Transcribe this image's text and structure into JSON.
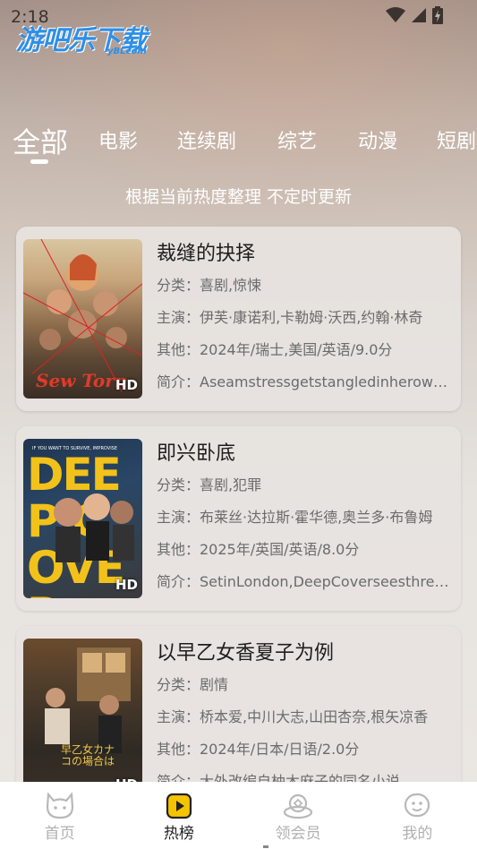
{
  "status_bar": {
    "time": "2:18"
  },
  "watermark": {
    "brand": "游吧乐下载",
    "domain": "yBLcom"
  },
  "tabs": [
    {
      "label": "全部",
      "active": true
    },
    {
      "label": "电影"
    },
    {
      "label": "连续剧"
    },
    {
      "label": "综艺"
    },
    {
      "label": "动漫"
    },
    {
      "label": "短剧"
    }
  ],
  "subtitle": "根据当前热度整理 不定时更新",
  "movies": [
    {
      "title": "裁缝的抉择",
      "genre": "分类：喜剧,惊悚",
      "cast": "主演：伊芙·康诺利,卡勒姆·沃西,约翰·林奇",
      "other": "其他：2024年/瑞士,美国/英语/9.0分",
      "intro": "简介：Aseamstressgetstangledinherownthreads",
      "poster_text": "Sew Torn",
      "badge": "HD"
    },
    {
      "title": "即兴卧底",
      "genre": "分类：喜剧,犯罪",
      "cast": "主演：布莱丝·达拉斯·霍华德,奥兰多·布鲁姆",
      "other": "其他：2025年/英国/英语/8.0分",
      "intro": "简介：SetinLondon,DeepCoverseesthreeimprov",
      "poster_text": "DEEP COVER",
      "poster_tagline": "IF YOU WANT TO SURVIVE, IMPROVISE",
      "badge": "HD"
    },
    {
      "title": "以早乙女香夏子为例",
      "genre": "分类：剧情",
      "cast": "主演：桥本爱,中川大志,山田杏奈,根矢凉香",
      "other": "其他：2024年/日本/日语/2.0分",
      "intro": "简介：大外改编自柚木麻子的同名小说",
      "poster_text": "早乙女カナコの場合は",
      "badge": "HD"
    }
  ],
  "bottom_nav": [
    {
      "label": "首页",
      "icon": "cat-face-icon"
    },
    {
      "label": "热榜",
      "icon": "play-square-icon",
      "active": true
    },
    {
      "label": "领会员",
      "icon": "vip-crown-icon"
    },
    {
      "label": "我的",
      "icon": "smile-face-icon"
    }
  ],
  "colors": {
    "accent": "#f5c400",
    "brand_blue": "#2f8fe6"
  }
}
